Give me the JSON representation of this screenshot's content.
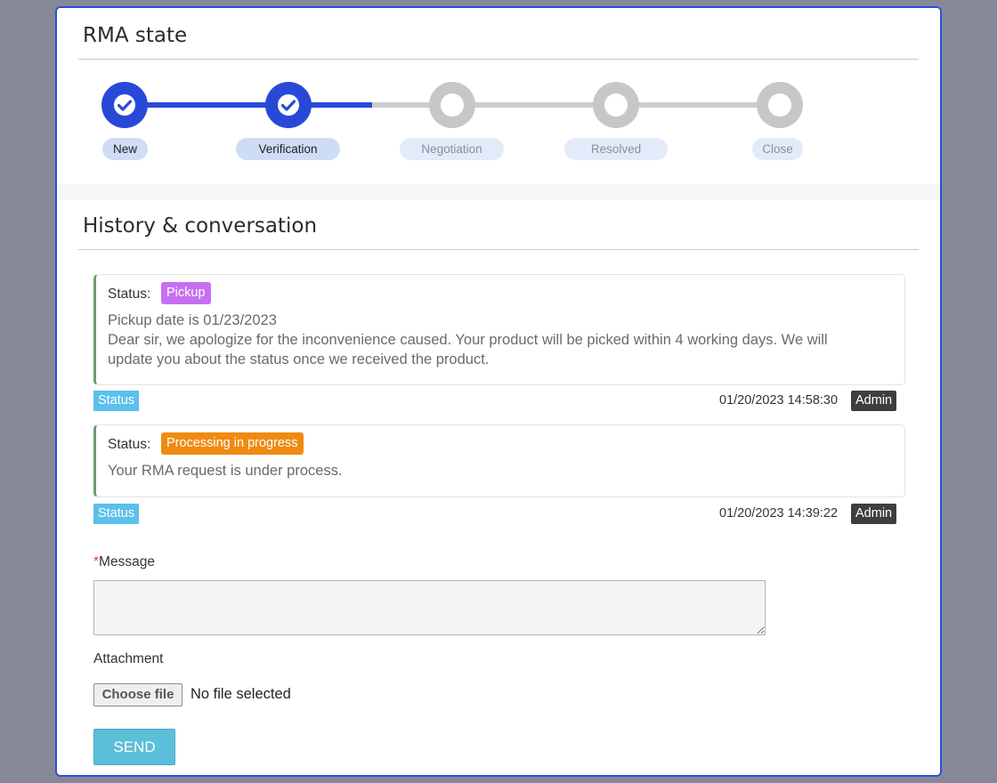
{
  "rma_state": {
    "title": "RMA state",
    "steps": [
      {
        "label": "New",
        "state": "done"
      },
      {
        "label": "Verification",
        "state": "done"
      },
      {
        "label": "Negotiation",
        "state": "pending"
      },
      {
        "label": "Resolved",
        "state": "pending"
      },
      {
        "label": "Close",
        "state": "pending"
      }
    ]
  },
  "history": {
    "title": "History & conversation",
    "entries": [
      {
        "status_prefix": "Status:",
        "status": "Pickup",
        "status_color": "#c86ff0",
        "line1": "Pickup date is 01/23/2023",
        "line2": "Dear sir, we apologize for the inconvenience caused. Your product will be picked within 4 working days. We will",
        "line3": "update you about the status once we received the product.",
        "type_badge": "Status",
        "timestamp": "01/20/2023 14:58:30",
        "author": "Admin"
      },
      {
        "status_prefix": "Status:",
        "status": "Processing in progress",
        "status_color": "#ef8b12",
        "line1": "Your RMA request is under process.",
        "type_badge": "Status",
        "timestamp": "01/20/2023 14:39:22",
        "author": "Admin"
      }
    ]
  },
  "form": {
    "message_required_mark": "*",
    "message_label": "Message",
    "message_value": "",
    "attachment_label": "Attachment",
    "choose_file_label": "Choose file",
    "no_file_text": "No file selected",
    "send_label": "SEND"
  },
  "colors": {
    "accent": "#2849d8",
    "frame_border": "#2a4fe0",
    "send_button": "#5bbfd9",
    "status_badge": "#5bc0eb"
  }
}
